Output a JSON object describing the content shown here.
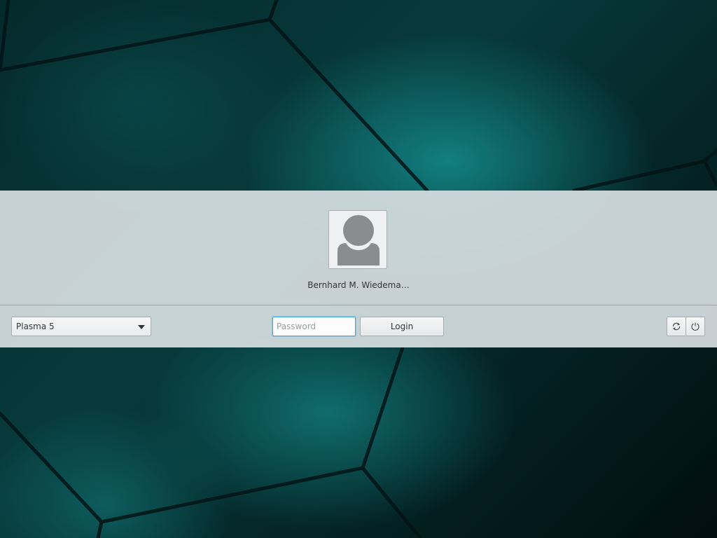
{
  "login": {
    "user_name": "Bernhard M. Wiedema…",
    "avatar_icon": "user-silhouette-icon",
    "session": {
      "selected": "Plasma 5"
    },
    "password": {
      "placeholder": "Password",
      "value": ""
    },
    "login_label": "Login",
    "actions": [
      {
        "name": "reboot",
        "icon": "reboot-icon"
      },
      {
        "name": "shutdown",
        "icon": "power-icon"
      }
    ]
  },
  "colors": {
    "focus_accent": "#3daee9",
    "panel_bg": "#d6dee0",
    "text": "#31363b",
    "wallpaper_teal": "#148c8c"
  }
}
